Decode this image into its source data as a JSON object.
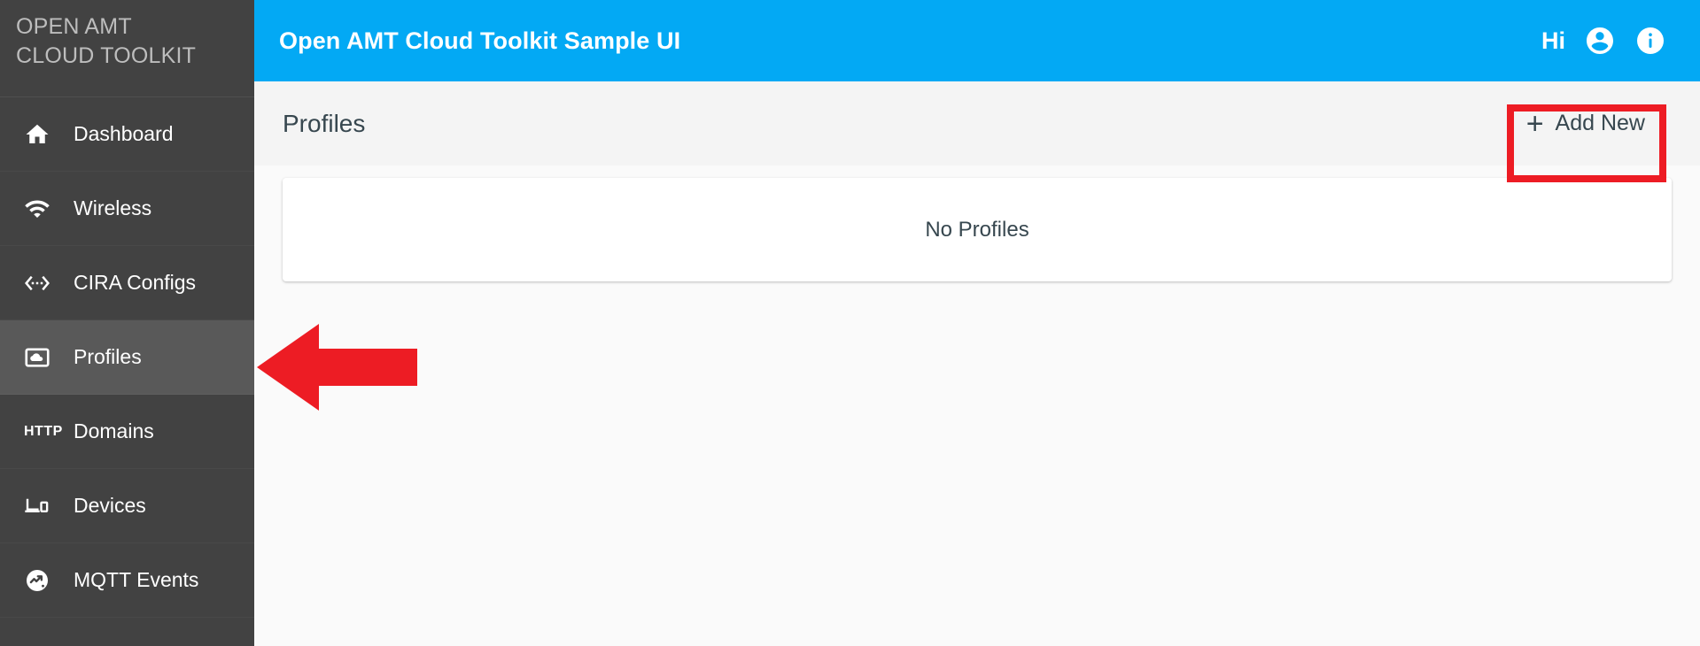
{
  "brand": {
    "line1": "OPEN AMT",
    "line2": "CLOUD TOOLKIT"
  },
  "sidebar": {
    "items": [
      {
        "label": "Dashboard",
        "icon": "home-icon",
        "active": false
      },
      {
        "label": "Wireless",
        "icon": "wifi-icon",
        "active": false
      },
      {
        "label": "CIRA Configs",
        "icon": "settings-ethernet-icon",
        "active": false
      },
      {
        "label": "Profiles",
        "icon": "cloud-frame-icon",
        "active": true
      },
      {
        "label": "Domains",
        "icon": "http-icon",
        "active": false
      },
      {
        "label": "Devices",
        "icon": "devices-icon",
        "active": false
      },
      {
        "label": "MQTT Events",
        "icon": "insights-circle-icon",
        "active": false
      }
    ]
  },
  "topbar": {
    "title": "Open AMT Cloud Toolkit Sample UI",
    "greeting": "Hi",
    "account_icon": "account-circle-icon",
    "info_icon": "info-circle-icon",
    "background_color": "#03a9f4"
  },
  "page": {
    "title": "Profiles",
    "add_new_label": "Add New",
    "add_new_icon": "plus-icon"
  },
  "content": {
    "empty_message": "No Profiles"
  },
  "annotations": {
    "highlight_color": "#ed1c24",
    "box_target": "add-new-button",
    "arrow_target": "sidebar-item-profiles"
  }
}
